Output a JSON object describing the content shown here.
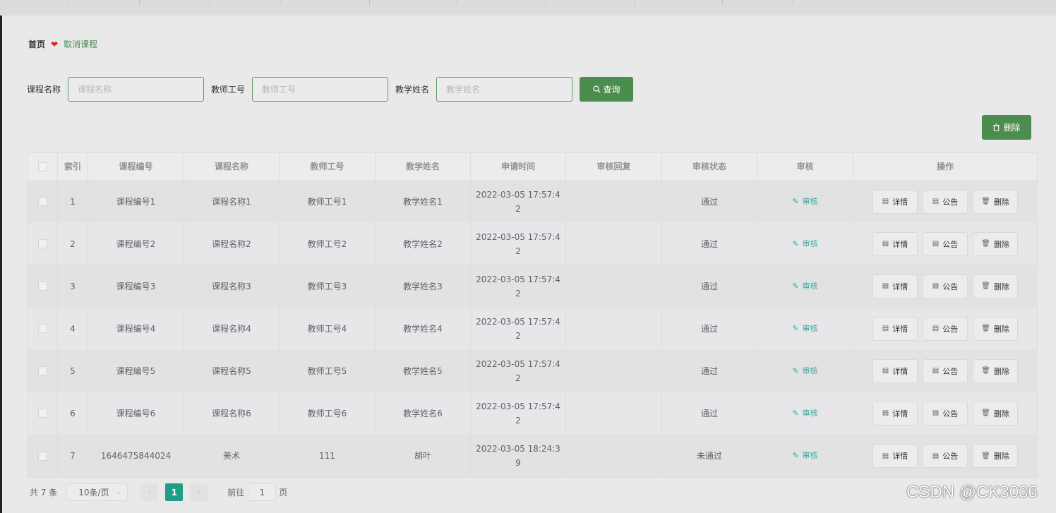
{
  "breadcrumb": {
    "home": "首页",
    "current": "取消课程"
  },
  "search": {
    "fields": [
      {
        "label": "课程名称",
        "placeholder": "课程名称"
      },
      {
        "label": "教师工号",
        "placeholder": "教师工号"
      },
      {
        "label": "教学姓名",
        "placeholder": "教学姓名"
      }
    ],
    "query_label": "查询"
  },
  "toolbar": {
    "delete_label": "删除"
  },
  "table": {
    "headers": [
      "索引",
      "课程编号",
      "课程名称",
      "教师工号",
      "教学姓名",
      "申请时间",
      "审核回复",
      "审核状态",
      "审核",
      "操作"
    ],
    "audit_label": "审核",
    "actions": {
      "detail": "详情",
      "notice": "公告",
      "delete": "删除"
    },
    "rows": [
      {
        "index": "1",
        "course_no": "课程编号1",
        "course_name": "课程名称1",
        "teacher_no": "教师工号1",
        "teacher_name": "教学姓名1",
        "apply_time": "2022-03-05 17:57:42",
        "reply": "",
        "status": "通过"
      },
      {
        "index": "2",
        "course_no": "课程编号2",
        "course_name": "课程名称2",
        "teacher_no": "教师工号2",
        "teacher_name": "教学姓名2",
        "apply_time": "2022-03-05 17:57:42",
        "reply": "",
        "status": "通过"
      },
      {
        "index": "3",
        "course_no": "课程编号3",
        "course_name": "课程名称3",
        "teacher_no": "教师工号3",
        "teacher_name": "教学姓名3",
        "apply_time": "2022-03-05 17:57:42",
        "reply": "",
        "status": "通过"
      },
      {
        "index": "4",
        "course_no": "课程编号4",
        "course_name": "课程名称4",
        "teacher_no": "教师工号4",
        "teacher_name": "教学姓名4",
        "apply_time": "2022-03-05 17:57:42",
        "reply": "",
        "status": "通过"
      },
      {
        "index": "5",
        "course_no": "课程编号5",
        "course_name": "课程名称5",
        "teacher_no": "教师工号5",
        "teacher_name": "教学姓名5",
        "apply_time": "2022-03-05 17:57:42",
        "reply": "",
        "status": "通过"
      },
      {
        "index": "6",
        "course_no": "课程编号6",
        "course_name": "课程名称6",
        "teacher_no": "教师工号6",
        "teacher_name": "教学姓名6",
        "apply_time": "2022-03-05 17:57:42",
        "reply": "",
        "status": "通过"
      },
      {
        "index": "7",
        "course_no": "1646475844024",
        "course_name": "美术",
        "teacher_no": "111",
        "teacher_name": "胡叶",
        "apply_time": "2022-03-05 18:24:39",
        "reply": "",
        "status": "未通过"
      }
    ]
  },
  "pagination": {
    "total_text": "共 7 条",
    "page_size": "10条/页",
    "current_page": "1",
    "goto_prefix": "前往",
    "goto_value": "1",
    "goto_suffix": "页"
  },
  "watermark": "CSDN @CK3036",
  "colors": {
    "accent": "#4c8c4f",
    "page_active": "#1f9e86",
    "audit_link": "#38a89d",
    "heart": "#e02020"
  }
}
